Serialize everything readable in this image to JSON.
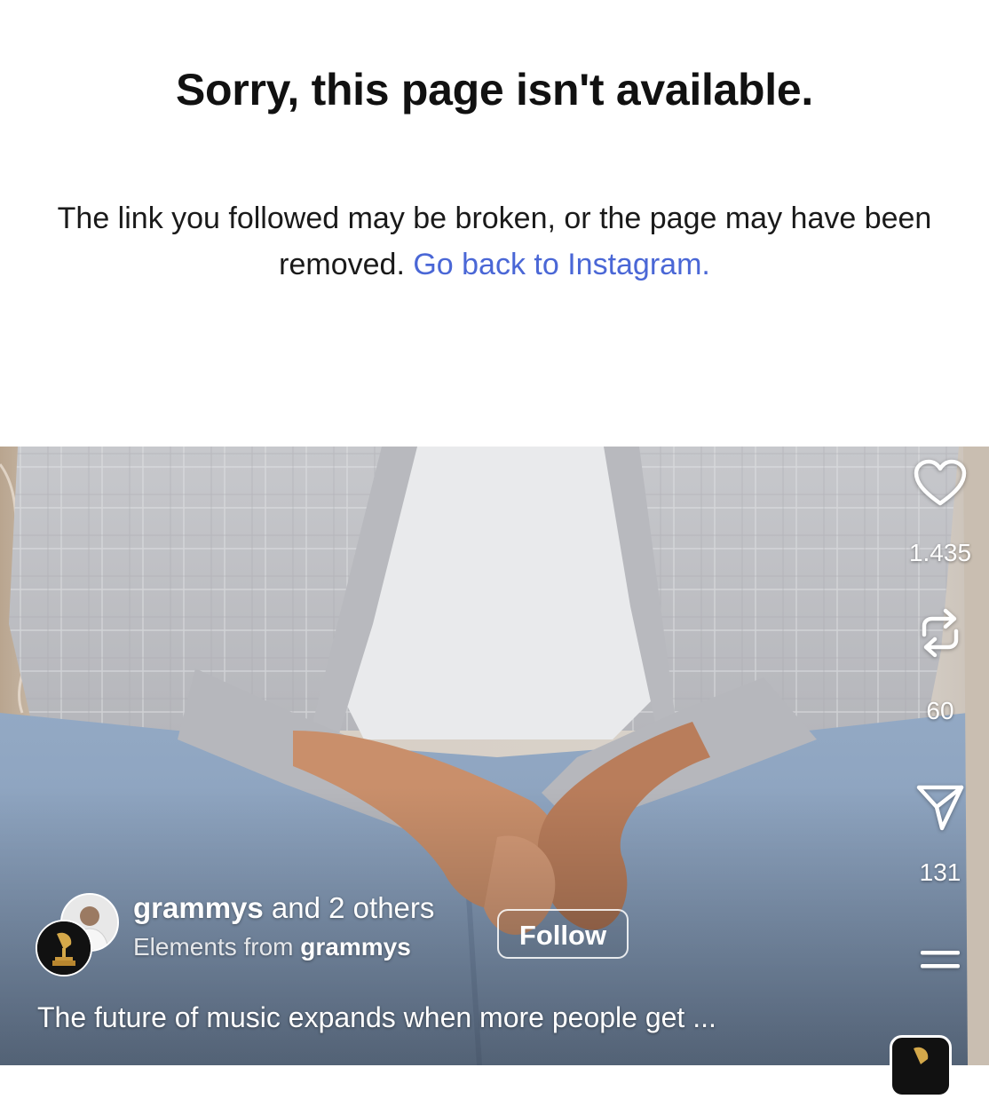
{
  "error": {
    "title": "Sorry, this page isn't available.",
    "message": "The link you followed may be broken, or the page may have been removed.",
    "link_label": "Go back to Instagram."
  },
  "reel": {
    "actions": {
      "like_icon": "heart-icon",
      "like_count": "1.435",
      "repost_icon": "repost-icon",
      "repost_count": "60",
      "share_icon": "send-icon",
      "share_count": "131",
      "more_icon": "more-icon"
    },
    "author": {
      "name": "grammys",
      "others": "and 2 others",
      "sub_prefix": "Elements from",
      "sub_name": "grammys"
    },
    "follow_label": "Follow",
    "caption": "The future of music expands when more people get ..."
  },
  "colors": {
    "link": "#4a67d6",
    "title_text": "#111111"
  }
}
